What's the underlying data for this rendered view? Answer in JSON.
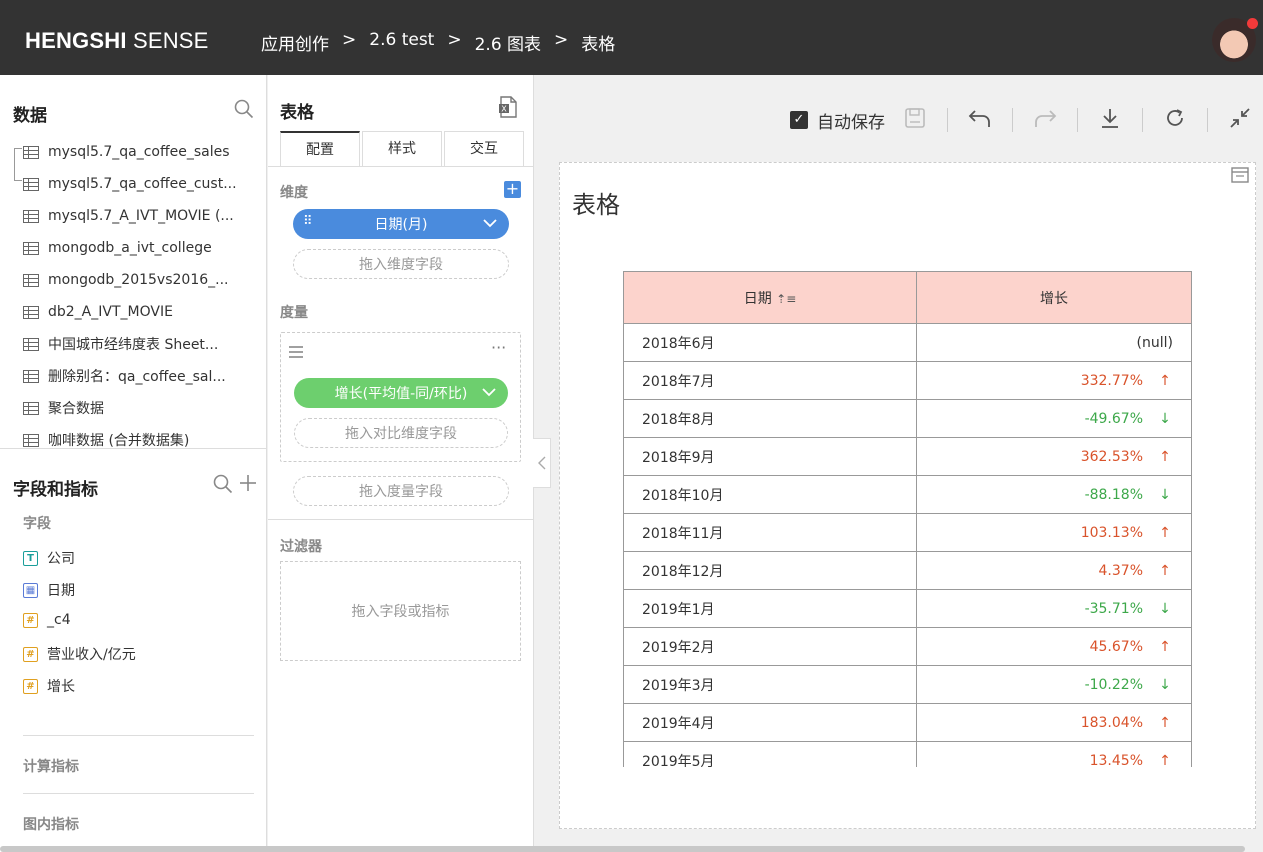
{
  "header": {
    "logo_bold": "HENGSHI",
    "logo_light": "SENSE",
    "breadcrumbs": [
      "应用创作",
      "2.6 test",
      "2.6 图表",
      "表格"
    ],
    "sep": ">"
  },
  "data_panel": {
    "title": "数据",
    "datasets": [
      "mysql5.7_qa_coffee_sales",
      "mysql5.7_qa_coffee_cust...",
      "mysql5.7_A_IVT_MOVIE (...",
      "mongodb_a_ivt_college",
      "mongodb_2015vs2016_...",
      "db2_A_IVT_MOVIE",
      "中国城市经纬度表 Sheet...",
      "删除别名：qa_coffee_sal...",
      "聚合数据",
      "咖啡数据 (合并数据集)"
    ]
  },
  "fields_panel": {
    "title": "字段和指标",
    "section_fields": "字段",
    "fields": [
      {
        "icon": "T",
        "label": "公司"
      },
      {
        "icon": "▦",
        "label": "日期"
      },
      {
        "icon": "#",
        "label": "_c4"
      },
      {
        "icon": "#",
        "label": "营业收入/亿元"
      },
      {
        "icon": "#",
        "label": "增长"
      }
    ],
    "section_calc": "计算指标",
    "section_inner": "图内指标"
  },
  "config": {
    "title": "表格",
    "tabs": [
      "配置",
      "样式",
      "交互"
    ],
    "dimension_label": "维度",
    "dimension_pill": "日期(月)",
    "dimension_drop": "拖入维度字段",
    "measure_label": "度量",
    "measure_pill": "增长(平均值-同/环比)",
    "compare_drop": "拖入对比维度字段",
    "measure_drop": "拖入度量字段",
    "filter_label": "过滤器",
    "filter_drop": "拖入字段或指标"
  },
  "toolbar": {
    "autosave": "自动保存"
  },
  "chart": {
    "title": "表格",
    "col_date": "日期",
    "col_growth": "增长",
    "rows": [
      {
        "date": "2018年6月",
        "value": "(null)",
        "dir": "none"
      },
      {
        "date": "2018年7月",
        "value": "332.77%",
        "dir": "up"
      },
      {
        "date": "2018年8月",
        "value": "-49.67%",
        "dir": "down"
      },
      {
        "date": "2018年9月",
        "value": "362.53%",
        "dir": "up"
      },
      {
        "date": "2018年10月",
        "value": "-88.18%",
        "dir": "down"
      },
      {
        "date": "2018年11月",
        "value": "103.13%",
        "dir": "up"
      },
      {
        "date": "2018年12月",
        "value": "4.37%",
        "dir": "up"
      },
      {
        "date": "2019年1月",
        "value": "-35.71%",
        "dir": "down"
      },
      {
        "date": "2019年2月",
        "value": "45.67%",
        "dir": "up"
      },
      {
        "date": "2019年3月",
        "value": "-10.22%",
        "dir": "down"
      },
      {
        "date": "2019年4月",
        "value": "183.04%",
        "dir": "up"
      },
      {
        "date": "2019年5月",
        "value": "13.45%",
        "dir": "up"
      }
    ]
  }
}
